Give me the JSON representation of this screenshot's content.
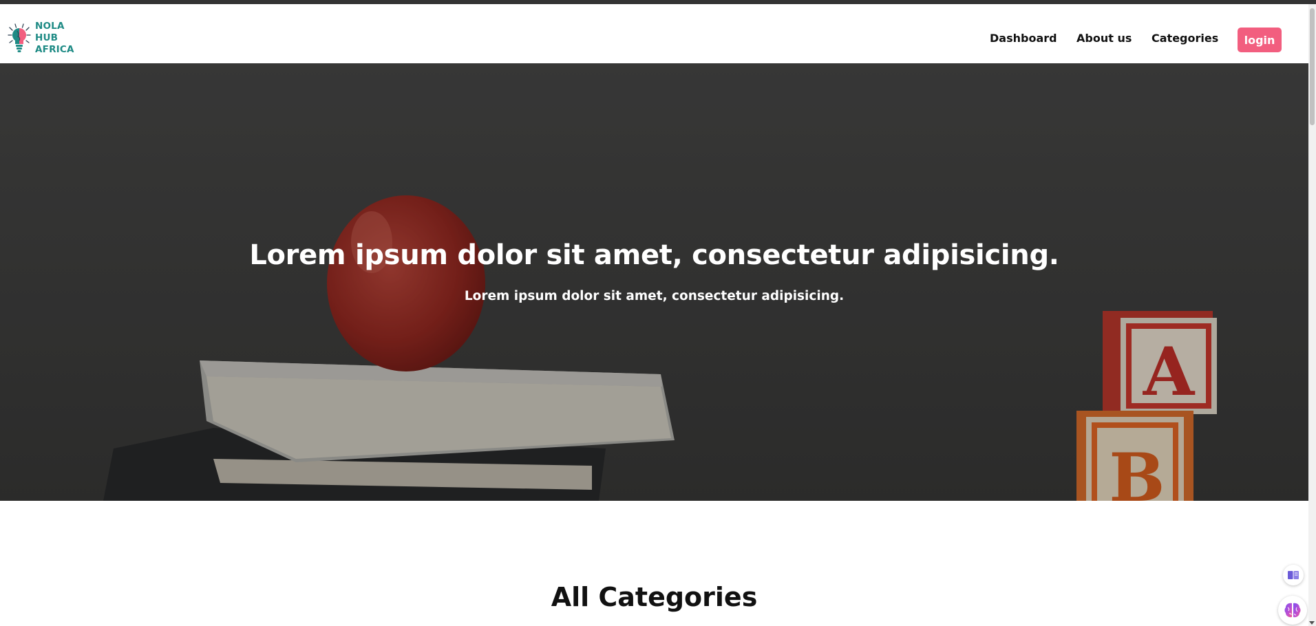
{
  "brand": {
    "lines": [
      "NOLA",
      "HUB",
      "AFRICA"
    ],
    "color": "#1d8a84",
    "icon": "lightbulb-icon"
  },
  "nav": {
    "items": [
      {
        "label": "Dashboard"
      },
      {
        "label": "About us"
      },
      {
        "label": "Categories"
      }
    ],
    "login_label": "login",
    "login_color": "#f25e7f"
  },
  "hero": {
    "title": "Lorem ipsum dolor sit amet, consectetur adipisicing.",
    "subtitle": "Lorem ipsum dolor sit amet, consectetur adipisicing."
  },
  "section": {
    "title": "All Categories"
  },
  "widgets": {
    "book_icon": "book-icon",
    "brain_icon": "brain-icon"
  }
}
